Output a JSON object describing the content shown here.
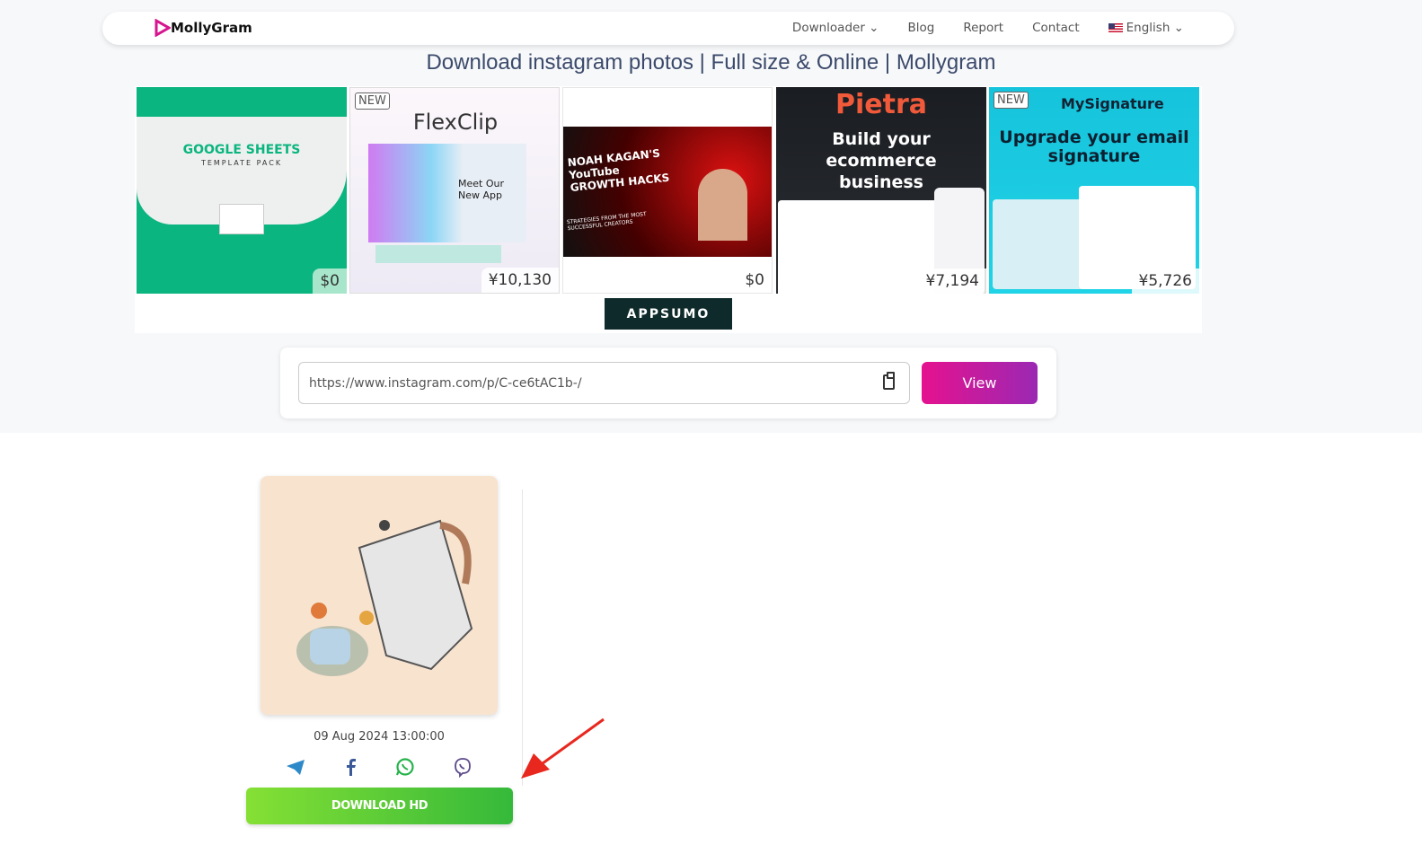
{
  "nav": {
    "logo": "MollyGram",
    "links": [
      "Downloader",
      "Blog",
      "Report",
      "Contact"
    ],
    "language": "English"
  },
  "title": "Download instagram photos | Full size & Online | Mollygram",
  "ads": [
    {
      "headline": "GOOGLE SHEETS",
      "sub": "TEMPLATE PACK",
      "price": "$0",
      "bg": "#0bb57f"
    },
    {
      "headline": "FlexClip",
      "sub": "Meet Our New App",
      "price": "¥10,130",
      "tag": "NEW"
    },
    {
      "headline": "NOAH KAGAN'S YouTube GROWTH HACKS",
      "sub": "STRATEGIES FROM THE MOST SUCCESSFUL CREATORS",
      "price": "$0"
    },
    {
      "headline": "Pietra",
      "sub": "Build your ecommerce business",
      "price": "¥7,194"
    },
    {
      "headline": "MySignature",
      "sub": "Upgrade your email signature",
      "price": "¥5,726",
      "tag": "NEW"
    }
  ],
  "ad_brand": "APPSUMO",
  "search": {
    "value": "https://www.instagram.com/p/C-ce6tAC1b-/",
    "button": "View"
  },
  "post": {
    "date": "09 Aug 2024 13:00:00",
    "download": "DOWNLOAD HD",
    "share": [
      "telegram",
      "facebook",
      "whatsapp",
      "viber"
    ]
  },
  "colors": {
    "accent": "#e5128f",
    "download": "#4cc43a",
    "annotation_arrow": "#e8281f"
  }
}
